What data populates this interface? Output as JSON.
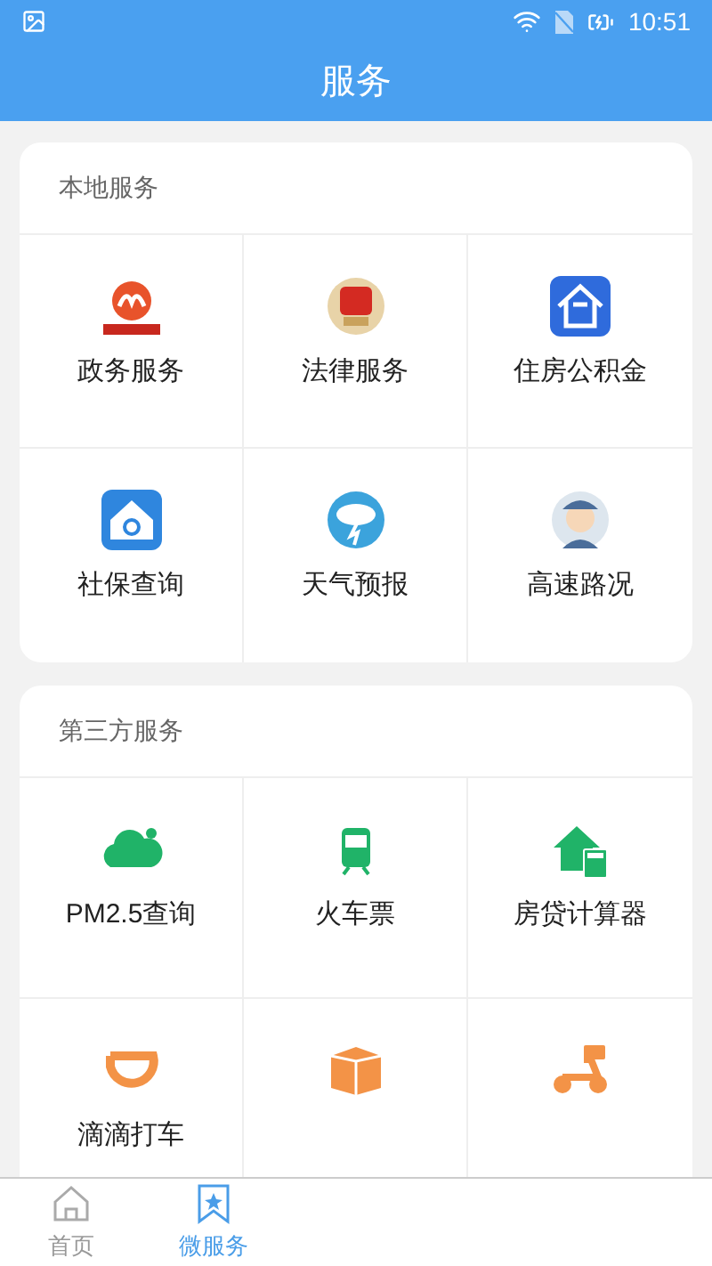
{
  "status_bar": {
    "time": "10:51"
  },
  "header": {
    "title": "服务"
  },
  "sections": [
    {
      "title": "本地服务",
      "items": [
        {
          "kind": "labeled",
          "label": "政务服务"
        },
        {
          "kind": "labeled",
          "label": "法律服务"
        },
        {
          "kind": "labeled",
          "label": "住房公积金"
        },
        {
          "kind": "labeled",
          "label": "社保查询"
        },
        {
          "kind": "labeled",
          "label": "天气预报"
        },
        {
          "kind": "labeled",
          "label": "高速路况"
        }
      ]
    },
    {
      "title": "第三方服务",
      "items": [
        {
          "kind": "labeled",
          "label": "PM2.5查询"
        },
        {
          "kind": "labeled",
          "label": "火车票"
        },
        {
          "kind": "labeled",
          "label": "房贷计算器"
        },
        {
          "kind": "labeled",
          "label": "滴滴打车"
        },
        {
          "kind": "icon_only"
        },
        {
          "kind": "icon_only"
        }
      ]
    }
  ],
  "bottom_nav": [
    {
      "label": "首页",
      "selected": false
    },
    {
      "label": "微服务",
      "selected": true
    }
  ]
}
